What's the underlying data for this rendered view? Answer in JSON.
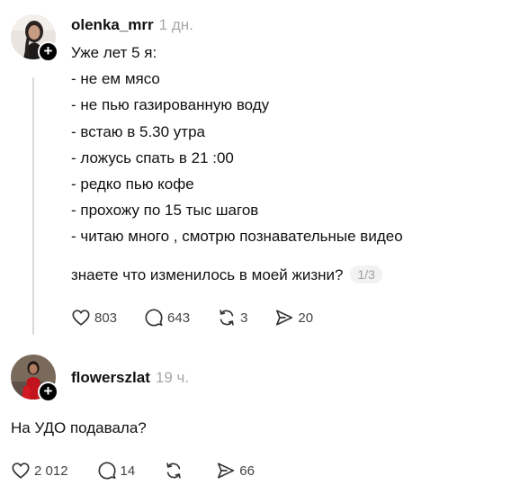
{
  "posts": [
    {
      "username": "olenka_mrr",
      "time": "1 дн.",
      "avatar_icon": "woman-portrait-avatar",
      "lines": [
        "Уже лет 5 я:",
        "- не ем мясо",
        "- не пью газированную воду",
        "- встаю в 5.30 утра",
        "- ложусь спать в 21 :00",
        "- редко пью кофе",
        "- прохожу по 15 тыс шагов",
        "- читаю много , смотрю познавательные видео"
      ],
      "question": "знаете что изменилось в моей жизни?",
      "pager": "1/3",
      "likes": "803",
      "comments": "643",
      "reposts": "3",
      "shares": "20"
    },
    {
      "username": "flowerszlat",
      "time": "19 ч.",
      "avatar_icon": "woman-red-dress-avatar",
      "text": "На УДО подавала?",
      "likes": "2 012",
      "comments": "14",
      "reposts": "",
      "shares": "66"
    }
  ],
  "follow_badge": "+",
  "icons": {
    "like": "heart-icon",
    "comment": "comment-bubble-icon",
    "repost": "repost-icon",
    "share": "send-icon"
  },
  "colors": {
    "text": "#111111",
    "muted": "#a8a8a8",
    "icon": "#444444",
    "thread_line": "#d9d9d9"
  }
}
